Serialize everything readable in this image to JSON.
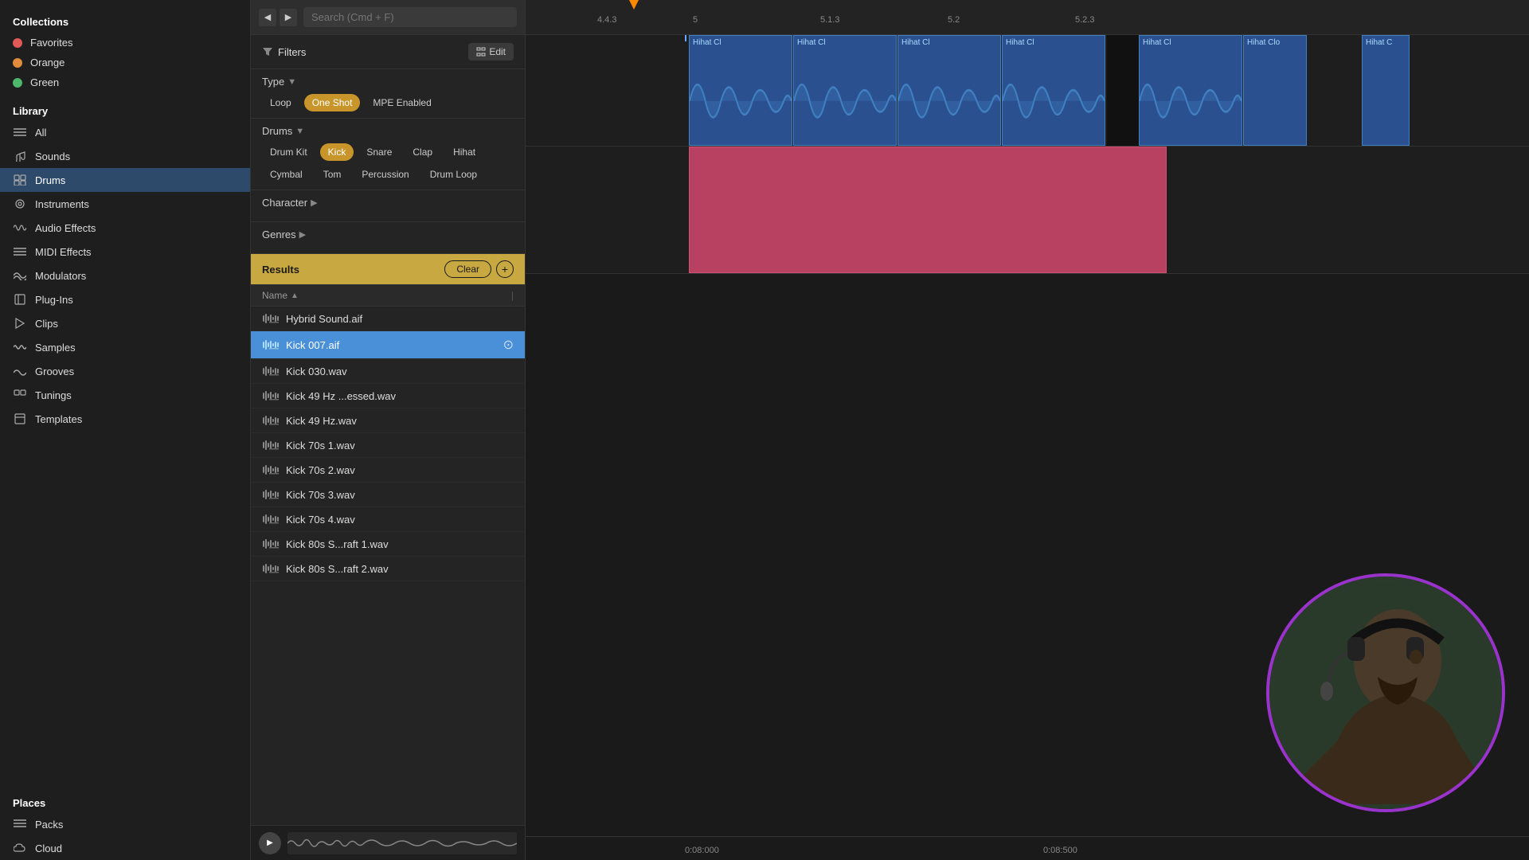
{
  "sidebar": {
    "collections_label": "Collections",
    "favorites_label": "Favorites",
    "orange_label": "Orange",
    "green_label": "Green",
    "library_label": "Library",
    "nav_items": [
      {
        "id": "all",
        "label": "All",
        "icon": "≡≡≡"
      },
      {
        "id": "sounds",
        "label": "Sounds",
        "icon": "♪"
      },
      {
        "id": "drums",
        "label": "Drums",
        "icon": "⊞",
        "active": true
      },
      {
        "id": "instruments",
        "label": "Instruments",
        "icon": "◎"
      },
      {
        "id": "audio-effects",
        "label": "Audio Effects",
        "icon": "≋"
      },
      {
        "id": "midi-effects",
        "label": "MIDI Effects",
        "icon": "≡"
      },
      {
        "id": "modulators",
        "label": "Modulators",
        "icon": "∿∿"
      },
      {
        "id": "plug-ins",
        "label": "Plug-Ins",
        "icon": "⊟"
      },
      {
        "id": "clips",
        "label": "Clips",
        "icon": "▶"
      },
      {
        "id": "samples",
        "label": "Samples",
        "icon": "≋"
      },
      {
        "id": "grooves",
        "label": "Grooves",
        "icon": "∿"
      },
      {
        "id": "tunings",
        "label": "Tunings",
        "icon": "⊞"
      },
      {
        "id": "templates",
        "label": "Templates",
        "icon": "⊟"
      }
    ],
    "places_label": "Places",
    "places_items": [
      {
        "id": "packs",
        "label": "Packs",
        "icon": "≋"
      },
      {
        "id": "cloud",
        "label": "Cloud",
        "icon": "☁"
      }
    ]
  },
  "filters": {
    "search_placeholder": "Search (Cmd + F)",
    "filters_label": "Filters",
    "edit_label": "Edit",
    "type_label": "Type",
    "type_tags": [
      {
        "id": "loop",
        "label": "Loop",
        "active": false
      },
      {
        "id": "one-shot",
        "label": "One Shot",
        "active": true
      },
      {
        "id": "mpe-enabled",
        "label": "MPE Enabled",
        "active": false
      }
    ],
    "drums_label": "Drums",
    "drum_tags": [
      {
        "id": "drum-kit",
        "label": "Drum Kit",
        "active": false
      },
      {
        "id": "kick",
        "label": "Kick",
        "active": true
      },
      {
        "id": "snare",
        "label": "Snare",
        "active": false
      },
      {
        "id": "clap",
        "label": "Clap",
        "active": false
      },
      {
        "id": "hihat",
        "label": "Hihat",
        "active": false
      },
      {
        "id": "cymbal",
        "label": "Cymbal",
        "active": false
      },
      {
        "id": "tom",
        "label": "Tom",
        "active": false
      },
      {
        "id": "percussion",
        "label": "Percussion",
        "active": false
      },
      {
        "id": "drum-loop",
        "label": "Drum Loop",
        "active": false
      }
    ],
    "character_label": "Character",
    "genres_label": "Genres",
    "results_label": "Results",
    "clear_label": "Clear",
    "name_col_label": "Name",
    "files": [
      {
        "id": 1,
        "name": "Hybrid Sound.aif",
        "selected": false
      },
      {
        "id": 2,
        "name": "Kick 007.aif",
        "selected": true
      },
      {
        "id": 3,
        "name": "Kick 030.wav",
        "selected": false
      },
      {
        "id": 4,
        "name": "Kick 49 Hz ...essed.wav",
        "selected": false
      },
      {
        "id": 5,
        "name": "Kick 49 Hz.wav",
        "selected": false
      },
      {
        "id": 6,
        "name": "Kick 70s 1.wav",
        "selected": false
      },
      {
        "id": 7,
        "name": "Kick 70s 2.wav",
        "selected": false
      },
      {
        "id": 8,
        "name": "Kick 70s 3.wav",
        "selected": false
      },
      {
        "id": 9,
        "name": "Kick 70s 4.wav",
        "selected": false
      },
      {
        "id": 10,
        "name": "Kick 80s S...raft 1.wav",
        "selected": false
      },
      {
        "id": 11,
        "name": "Kick 80s S...raft 2.wav",
        "selected": false
      }
    ]
  },
  "timeline": {
    "markers": [
      "4.4.3",
      "5",
      "5.1.3",
      "5.2",
      "5.2.3"
    ],
    "time_left": "0:08:000",
    "time_right": "0:08:500"
  },
  "clips": {
    "hihat_label": "Hihat Cl",
    "clip_labels": [
      "Hihat Cl",
      "Hihat Cl",
      "Hihat Cl",
      "Hihat Cl",
      "Hihat Cl",
      "Hihat Cl"
    ]
  }
}
